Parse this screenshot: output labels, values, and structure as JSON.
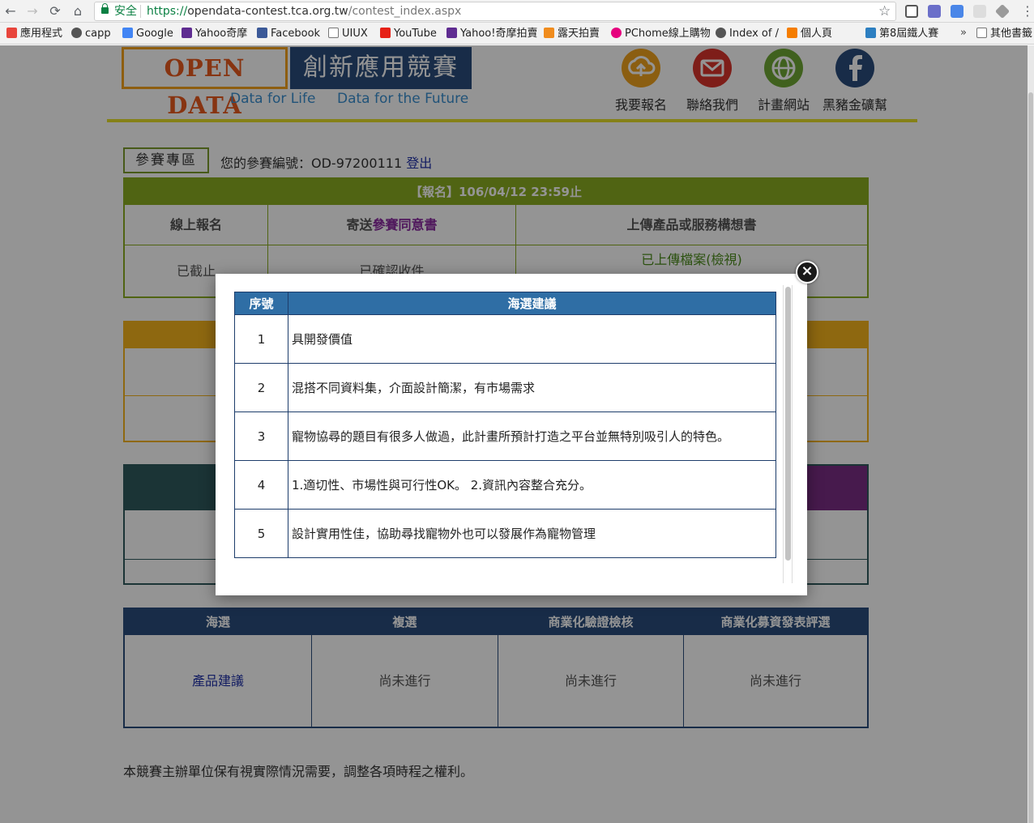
{
  "browser": {
    "secure_label": "安全",
    "url_scheme": "https://",
    "url_host": "opendata-contest.tca.org.tw",
    "url_path": "/contest_index.aspx",
    "bookmarks": [
      {
        "label": "應用程式",
        "icon": "apps-icon",
        "color": "#e8453c"
      },
      {
        "label": "capp",
        "icon": "github-icon",
        "color": "#555555"
      },
      {
        "label": "Google",
        "icon": "google-icon",
        "color": "#4285f4"
      },
      {
        "label": "Yahoo奇摩",
        "icon": "yahoo-icon",
        "color": "#5f2c91"
      },
      {
        "label": "Facebook",
        "icon": "facebook-icon",
        "color": "#3b5998"
      },
      {
        "label": "UIUX",
        "icon": "folder-icon",
        "color": "#8a8a8a"
      },
      {
        "label": "YouTube",
        "icon": "youtube-icon",
        "color": "#e62117"
      },
      {
        "label": "Yahoo!奇摩拍賣",
        "icon": "yahoo-icon",
        "color": "#5f2c91"
      },
      {
        "label": "露天拍賣",
        "icon": "ruten-icon",
        "color": "#f08c1e"
      },
      {
        "label": "PChome線上購物",
        "icon": "pchome-icon",
        "color": "#e6007e"
      },
      {
        "label": "Index of /",
        "icon": "github-icon",
        "color": "#555555"
      },
      {
        "label": "個人頁",
        "icon": "blogger-icon",
        "color": "#f57d00"
      },
      {
        "label": "第8屆鐵人賽",
        "icon": "ithome-icon",
        "color": "#2d7fc1"
      }
    ],
    "bookmarks_more": "»",
    "other_bookmarks": "其他書籤"
  },
  "header": {
    "logo_left": "OPEN DATA",
    "logo_right": "創新應用競賽",
    "tagline_1": "Data for Life",
    "tagline_2": "Data for the Future",
    "nav": [
      {
        "label": "我要報名",
        "icon": "upload-icon",
        "color": "#f0a21e"
      },
      {
        "label": "聯絡我們",
        "icon": "mail-icon",
        "color": "#d9342b"
      },
      {
        "label": "計畫網站",
        "icon": "globe-icon",
        "color": "#6ea735"
      },
      {
        "label": "黑豬金礦幫",
        "icon": "facebook-icon",
        "color": "#2a4c7c"
      }
    ]
  },
  "zone": {
    "title": "參賽專區",
    "contestant_prefix": "您的參賽編號：OD-97200111",
    "logout": "登出"
  },
  "registration": {
    "deadline": "【報名】106/04/12 23:59止",
    "col1_header": "線上報名",
    "col2_header_a": "寄送",
    "col2_header_b": "參賽同意書",
    "col3_header": "上傳產品或服務構想書",
    "col1_value": "已截止",
    "col2_value": "已確認收件",
    "col3_value": "已上傳檔案(檢視)"
  },
  "stages": {
    "headers": [
      "海選",
      "複選",
      "商業化驗證檢核",
      "商業化募資發表評選"
    ],
    "values": [
      "產品建議",
      "尚未進行",
      "尚未進行",
      "尚未進行"
    ]
  },
  "footer_note": "本競賽主辦單位保有視實際情況需要，調整各項時程之權利。",
  "modal": {
    "close_label": "×",
    "col_seq": "序號",
    "col_suggestion": "海選建議",
    "rows": [
      {
        "seq": "1",
        "text": "具開發價值"
      },
      {
        "seq": "2",
        "text": "混搭不同資料集，介面設計簡潔，有市場需求"
      },
      {
        "seq": "3",
        "text": "寵物協尋的題目有很多人做過，此計畫所預計打造之平台並無特別吸引人的特色。"
      },
      {
        "seq": "4",
        "text": "1.適切性、市場性與可行性OK。 2.資訊內容整合充分。"
      },
      {
        "seq": "5",
        "text": "設計實用性佳，協助尋找寵物外也可以發展作為寵物管理"
      }
    ]
  }
}
